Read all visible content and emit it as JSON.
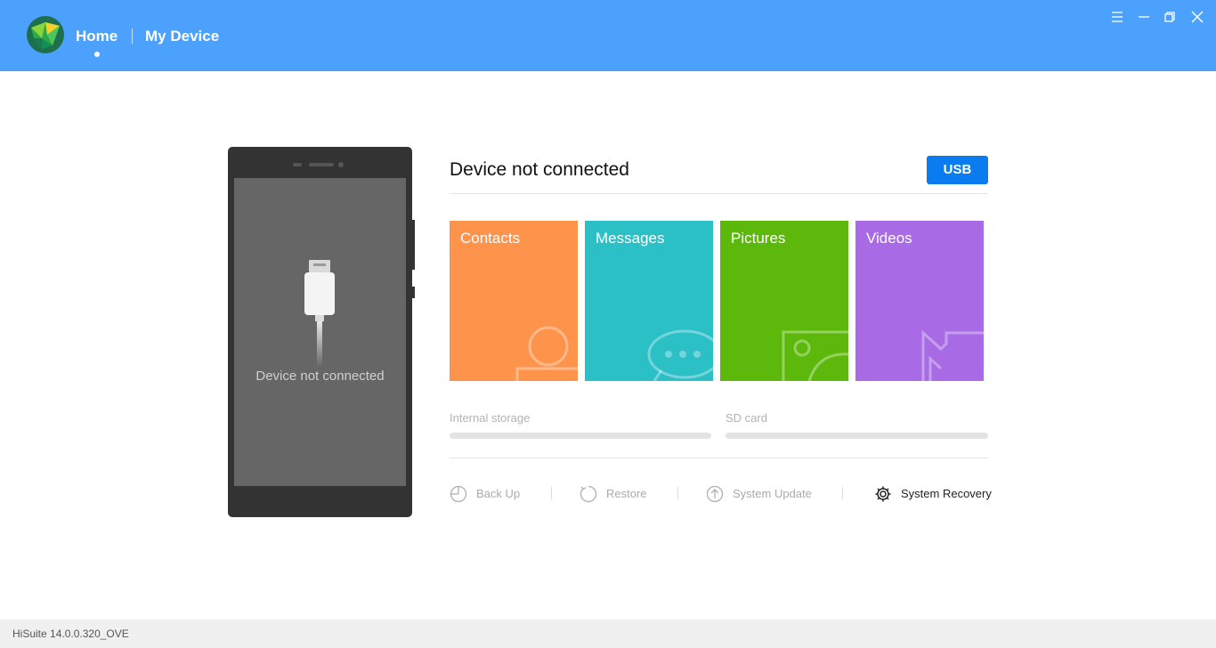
{
  "header": {
    "nav": {
      "home": "Home",
      "my_device": "My Device"
    },
    "window_controls": [
      "menu-icon",
      "minimize-icon",
      "restore-icon",
      "close-icon"
    ],
    "background_color": "#4ca1fc"
  },
  "phone": {
    "screen_text": "Device not connected"
  },
  "status": {
    "title": "Device not connected",
    "usb_label": "USB"
  },
  "tiles": [
    {
      "label": "Contacts",
      "color": "#fe944c",
      "icon": "contact-icon"
    },
    {
      "label": "Messages",
      "color": "#2bbfc6",
      "icon": "message-bubble-icon"
    },
    {
      "label": "Pictures",
      "color": "#5cb80a",
      "icon": "picture-icon"
    },
    {
      "label": "Videos",
      "color": "#a86be5",
      "icon": "video-icon"
    }
  ],
  "storage": {
    "internal_label": "Internal storage",
    "sd_label": "SD card"
  },
  "actions": {
    "backup": "Back Up",
    "restore": "Restore",
    "system_update": "System Update",
    "system_recovery": "System Recovery"
  },
  "footer": {
    "version": "HiSuite 14.0.0.320_OVE"
  }
}
